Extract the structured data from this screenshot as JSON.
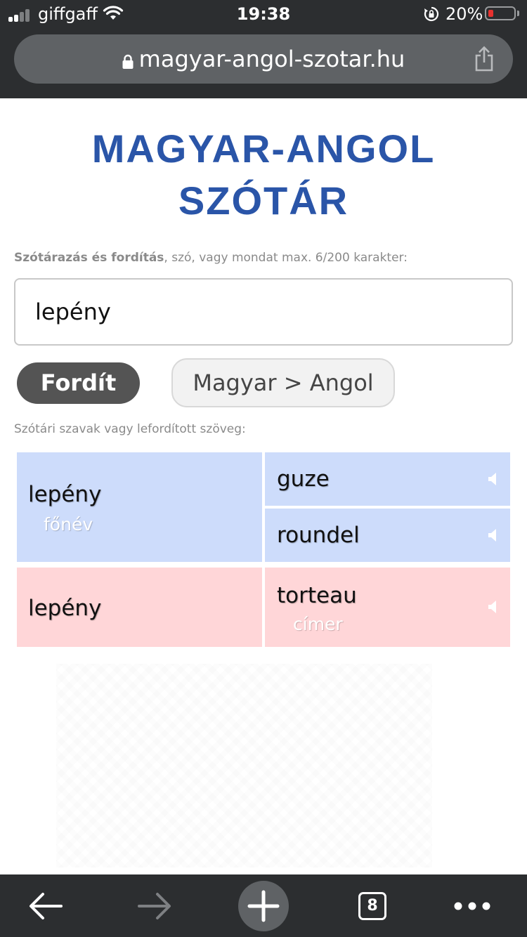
{
  "status": {
    "carrier": "giffgaff",
    "time": "19:38",
    "battery_pct": "20%"
  },
  "browser": {
    "url": "magyar-angol-szotar.hu",
    "tab_count": "8"
  },
  "page": {
    "title_line1": "MAGYAR-ANGOL",
    "title_line2": "SZÓTÁR",
    "hint_bold": "Szótárazás és fordítás",
    "hint_rest": ", szó, vagy mondat max. 6/200 karakter:",
    "search_value": "lepény",
    "translate_button": "Fordít",
    "direction_button": "Magyar > Angol",
    "results_label": "Szótári szavak vagy lefordított szöveg:"
  },
  "results": [
    {
      "source": "lepény",
      "source_pos": "főnév",
      "translations": [
        {
          "word": "guze"
        },
        {
          "word": "roundel"
        }
      ]
    },
    {
      "source": "lepény",
      "translations": [
        {
          "word": "torteau",
          "note": "címer"
        }
      ]
    }
  ],
  "colors": {
    "title": "#2a55a8",
    "row_blue": "#cddcfb",
    "row_pink": "#ffd6d8",
    "chrome": "#2c2e30"
  }
}
